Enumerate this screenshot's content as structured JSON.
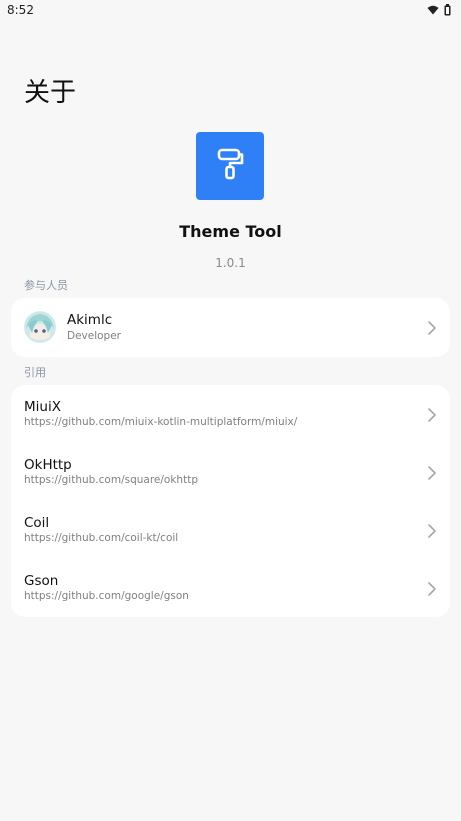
{
  "status_bar": {
    "time": "8:52",
    "icons": [
      "wifi-icon",
      "battery-icon"
    ]
  },
  "page": {
    "title": "关于"
  },
  "app": {
    "icon": "paint-roller-icon",
    "icon_color": "#2f7ff6",
    "name": "Theme Tool",
    "version": "1.0.1"
  },
  "contributors": {
    "section_label": "参与人员",
    "items": [
      {
        "name": "Akimlc",
        "role": "Developer",
        "avatar": "avatar-image"
      }
    ]
  },
  "references": {
    "section_label": "引用",
    "items": [
      {
        "name": "MiuiX",
        "url": "https://github.com/miuix-kotlin-multiplatform/miuix/"
      },
      {
        "name": "OkHttp",
        "url": "https://github.com/square/okhttp"
      },
      {
        "name": "Coil",
        "url": "https://github.com/coil-kt/coil"
      },
      {
        "name": "Gson",
        "url": "https://github.com/google/gson"
      }
    ]
  },
  "colors": {
    "background": "#f7f7f7",
    "card": "#ffffff",
    "accent": "#2f7ff6",
    "section_label": "#8a94a6"
  }
}
